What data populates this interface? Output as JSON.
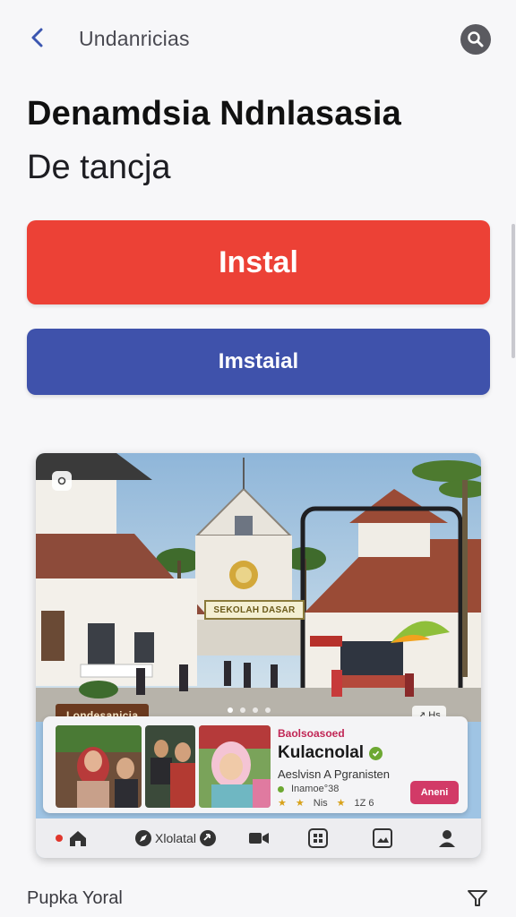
{
  "header": {
    "title": "Undanricias",
    "back_icon": "chevron-left-icon",
    "search_icon": "search-icon"
  },
  "hero_text": {
    "headline": "Denamdsia Ndnlasasia",
    "subhead": "De tancja"
  },
  "buttons": {
    "install_label": "Instal",
    "install_color": "#ec4136",
    "secondary_label": "Imstaial",
    "secondary_color": "#3f52ab"
  },
  "media": {
    "building_sign": "SEKOLAH DASAR",
    "location_tag": "Londesanicia",
    "corner_chip": "↗ Hs",
    "carousel_dots": 4,
    "active_dot": 1
  },
  "card": {
    "kicker": "Baolsoasoed",
    "title": "Kulacnolal",
    "subtitle": "Aeslvisn A Pgranisten",
    "meta_line": "Inamoe°38",
    "stat_1": "Nis",
    "stat_2": "1Z 6",
    "action_label": "Aneni"
  },
  "nav": {
    "items": [
      {
        "icon": "home-icon",
        "label": ""
      },
      {
        "icon": "compass-icon",
        "label": "Xlolatal"
      },
      {
        "icon": "video-icon",
        "label": ""
      },
      {
        "icon": "grid-icon",
        "label": ""
      },
      {
        "icon": "image-icon",
        "label": ""
      },
      {
        "icon": "profile-icon",
        "label": ""
      }
    ]
  },
  "footer": {
    "label": "Pupka Yoral",
    "filter_icon": "filter-icon"
  }
}
